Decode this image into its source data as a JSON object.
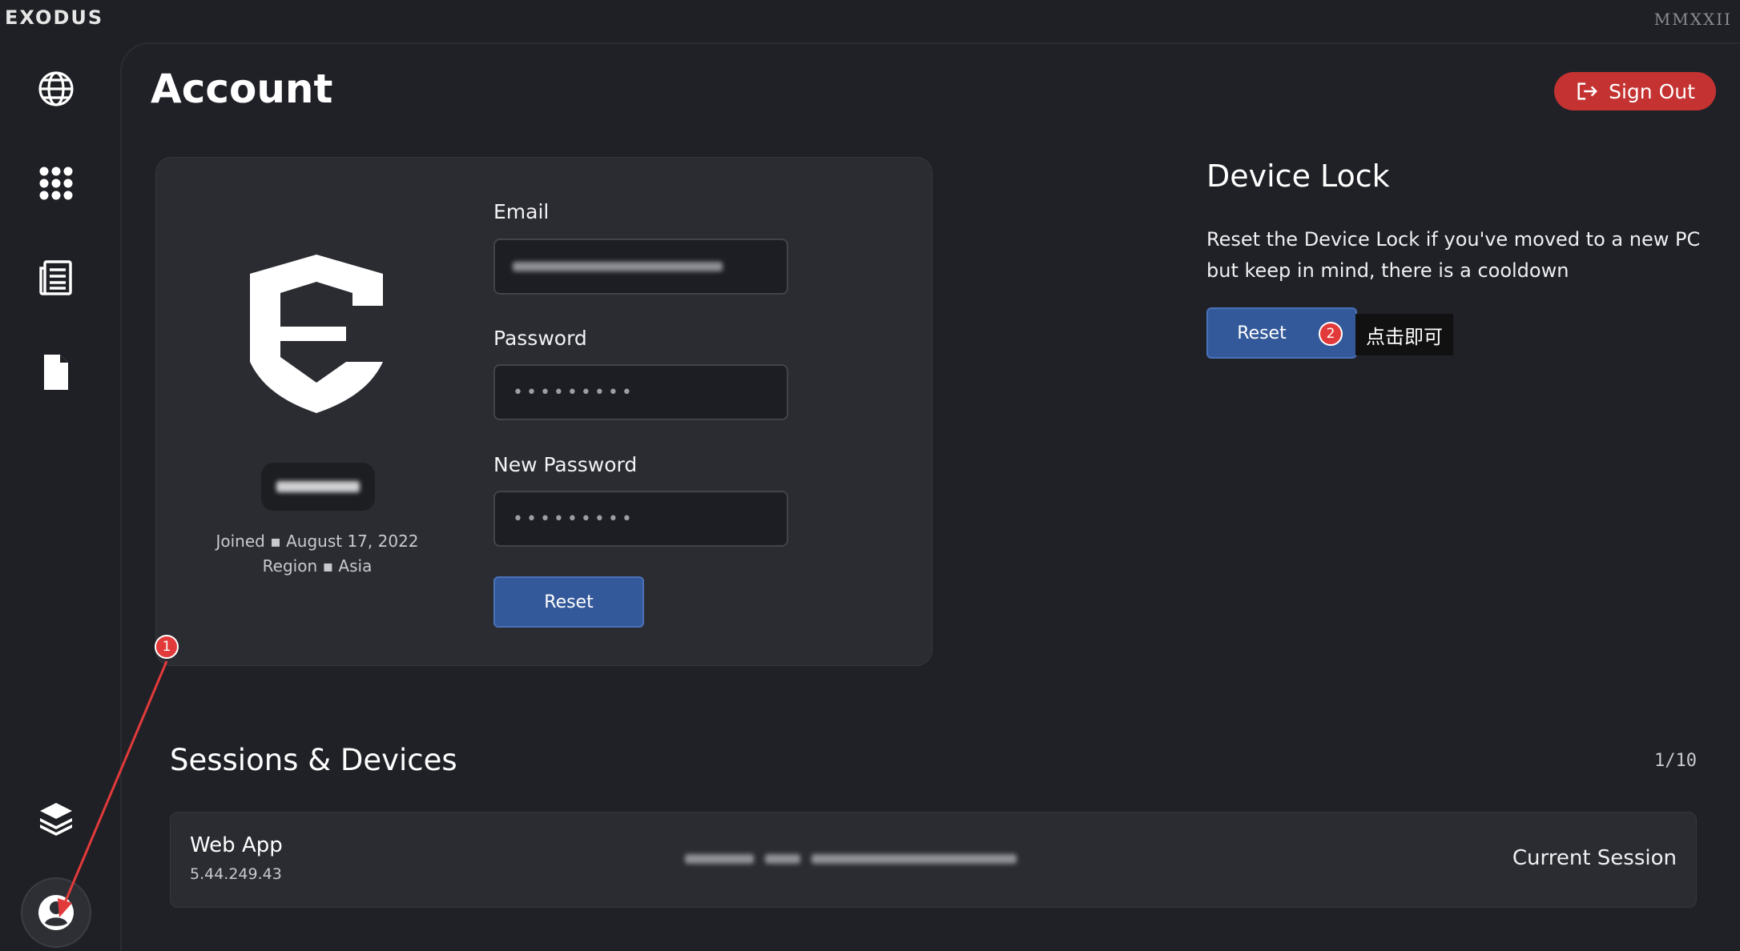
{
  "app": {
    "logo": "EXODUS",
    "year": "MMXXII"
  },
  "sidebar": {
    "items": [
      {
        "name": "globe-icon"
      },
      {
        "name": "apps-grid-icon"
      },
      {
        "name": "news-icon"
      },
      {
        "name": "document-icon"
      },
      {
        "name": "layers-icon"
      },
      {
        "name": "account-icon"
      }
    ]
  },
  "header": {
    "title": "Account",
    "signout_label": "Sign Out"
  },
  "account": {
    "joined_label": "Joined",
    "joined_value": "August 17, 2022",
    "region_label": "Region",
    "region_value": "Asia",
    "email_label": "Email",
    "password_label": "Password",
    "password_value": "•••••••••",
    "new_password_label": "New Password",
    "new_password_value": "•••••••••",
    "reset_label": "Reset"
  },
  "device_lock": {
    "title": "Device Lock",
    "description": "Reset the Device Lock if you've moved to a new PC but keep in mind, there is a cooldown",
    "reset_label": "Reset",
    "tooltip": "点击即可"
  },
  "annotations": {
    "badge_1": "1",
    "badge_2": "2",
    "color": "#e23a3a"
  },
  "sessions": {
    "title": "Sessions & Devices",
    "count": "1/10",
    "rows": [
      {
        "name": "Web App",
        "ip": "5.44.249.43",
        "status": "Current Session"
      }
    ]
  },
  "colors": {
    "background": "#1f2025",
    "card": "#2b2c32",
    "signout": "#c53232",
    "button": "#34599a"
  }
}
